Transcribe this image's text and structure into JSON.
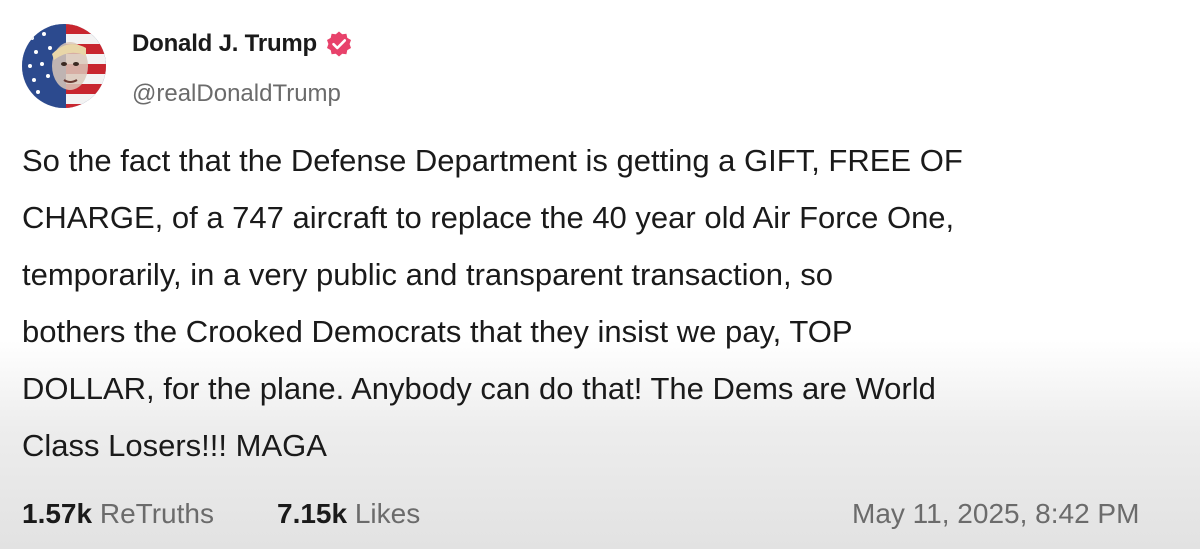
{
  "author": {
    "display_name": "Donald J. Trump",
    "handle": "@realDonaldTrump",
    "verified": true,
    "avatar_icon": "flag-portrait-avatar"
  },
  "post": {
    "lines": [
      "So the fact that the Defense Department is getting a GIFT, FREE OF",
      "CHARGE, of a 747 aircraft to replace the 40 year old Air Force One,",
      "temporarily, in a very public and transparent transaction, so",
      "bothers the Crooked Democrats that they insist we pay, TOP",
      "DOLLAR, for the plane. Anybody can do that! The Dems are World",
      "Class Losers!!! MAGA"
    ]
  },
  "stats": {
    "retruths_count": "1.57k",
    "retruths_label": "ReTruths",
    "likes_count": "7.15k",
    "likes_label": "Likes"
  },
  "timestamp": "May 11, 2025, 8:42 PM",
  "colors": {
    "text": "#1a1a1a",
    "muted": "#6b6b6b",
    "badge": "#e8426b"
  }
}
